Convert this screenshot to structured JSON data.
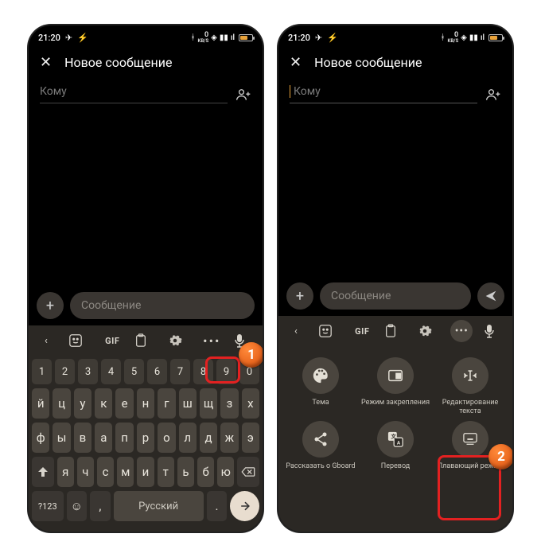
{
  "status": {
    "time": "21:20",
    "speed_value": "0",
    "speed_unit": "KB/S"
  },
  "header": {
    "title": "Новое сообщение"
  },
  "recipient": {
    "placeholder": "Кому"
  },
  "message": {
    "placeholder": "Сообщение"
  },
  "toolbar": {
    "gif": "GIF"
  },
  "keyboard": {
    "row_num": [
      "1",
      "2",
      "3",
      "4",
      "5",
      "6",
      "7",
      "8",
      "9",
      "0"
    ],
    "row1": [
      "й",
      "ц",
      "у",
      "к",
      "е",
      "н",
      "г",
      "ш",
      "щ",
      "з",
      "х"
    ],
    "row2": [
      "ф",
      "ы",
      "в",
      "а",
      "п",
      "р",
      "о",
      "л",
      "д",
      "ж",
      "э"
    ],
    "row3": [
      "я",
      "ч",
      "с",
      "м",
      "и",
      "т",
      "ь",
      "б",
      "ю"
    ],
    "symkey": "?123",
    "space": "Русский",
    "dot": "."
  },
  "panel": {
    "items": [
      {
        "label": "Тема"
      },
      {
        "label": "Режим закрепления"
      },
      {
        "label": "Редактирование\nтекста"
      },
      {
        "label": "Рассказать о Gboard"
      },
      {
        "label": "Перевод"
      },
      {
        "label": "Плавающий режим"
      }
    ]
  },
  "callouts": {
    "one": "1",
    "two": "2"
  }
}
